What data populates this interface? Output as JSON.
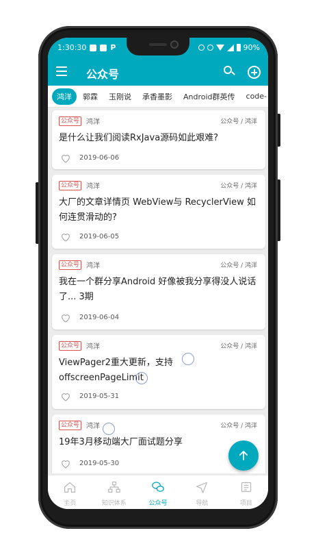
{
  "status_bar": {
    "time": "1:30:30",
    "battery": "90%"
  },
  "app_bar": {
    "title": "公众号"
  },
  "tabs": [
    {
      "label": "鸿洋",
      "active": true
    },
    {
      "label": "郭霖",
      "active": false
    },
    {
      "label": "玉刚说",
      "active": false
    },
    {
      "label": "承香墨影",
      "active": false
    },
    {
      "label": "Android群英传",
      "active": false
    },
    {
      "label": "code-",
      "active": false
    }
  ],
  "articles": [
    {
      "badge": "公众号",
      "author": "鸿洋",
      "chapter": "公众号 / 鸿洋",
      "title": "是什么让我们阅读RxJava源码如此艰难?",
      "date": "2019-06-06"
    },
    {
      "badge": "公众号",
      "author": "鸿洋",
      "chapter": "公众号 / 鸿洋",
      "title": "大厂的文章详情页 WebView与 RecyclerView 如何连贯滑动的?",
      "date": "2019-06-05"
    },
    {
      "badge": "公众号",
      "author": "鸿洋",
      "chapter": "公众号 / 鸿洋",
      "title": "我在一个群分享Android 好像被我分享得没人说话了... 3期",
      "date": "2019-06-04"
    },
    {
      "badge": "公众号",
      "author": "鸿洋",
      "chapter": "公众号 / 鸿洋",
      "title": "ViewPager2重大更新，支持offscreenPageLimit",
      "date": "2019-05-31"
    },
    {
      "badge": "公众号",
      "author": "鸿洋",
      "chapter": "公众号 / 鸿洋",
      "title": "19年3月移动端大厂面试题分享",
      "date": "2019-05-30"
    }
  ],
  "bottom_nav": [
    {
      "label": "主页",
      "icon": "home-icon",
      "active": false
    },
    {
      "label": "知识体系",
      "icon": "tree-icon",
      "active": false
    },
    {
      "label": "公众号",
      "icon": "wechat-icon",
      "active": true
    },
    {
      "label": "导航",
      "icon": "navigation-icon",
      "active": false
    },
    {
      "label": "项目",
      "icon": "project-icon",
      "active": false
    }
  ],
  "colors": {
    "primary": "#00a9be",
    "badge": "#d9534f"
  }
}
